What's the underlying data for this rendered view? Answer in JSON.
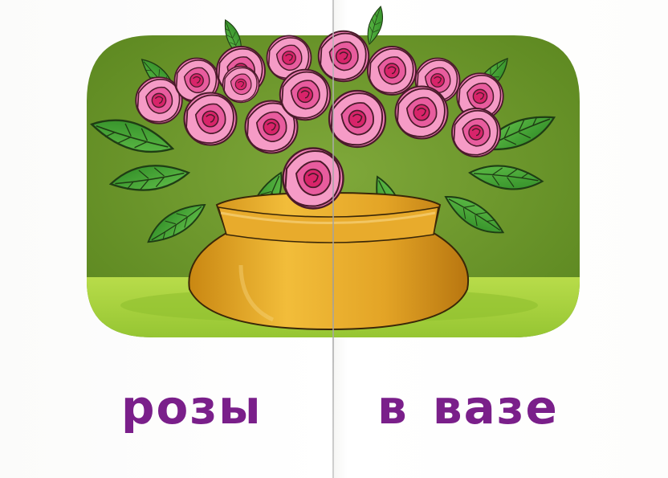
{
  "caption": {
    "left_word": "розы",
    "right_word": "в вазе"
  },
  "colors": {
    "background_panel": "#6f9a2a",
    "floor": "#a9d23c",
    "vase": "#d9a21e",
    "rose_petal": "#ef79b4",
    "rose_center": "#d8246a",
    "leaf": "#3e9a2e",
    "caption_text": "#7a1f8a"
  }
}
